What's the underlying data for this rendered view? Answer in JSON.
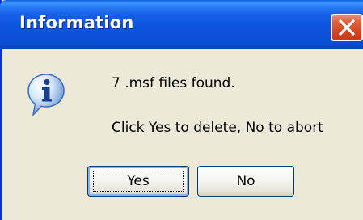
{
  "window": {
    "title": "Information"
  },
  "dialog": {
    "icon": "information-icon",
    "message_line1": "7 .msf files found.",
    "message_line2": "Click Yes to delete, No to abort"
  },
  "buttons": {
    "yes_label": "Yes",
    "no_label": "No"
  },
  "colors": {
    "titlebar": "#0a4ccf",
    "close_button": "#d3451f",
    "dialog_background": "#ece9d8",
    "button_border": "#003c74"
  }
}
